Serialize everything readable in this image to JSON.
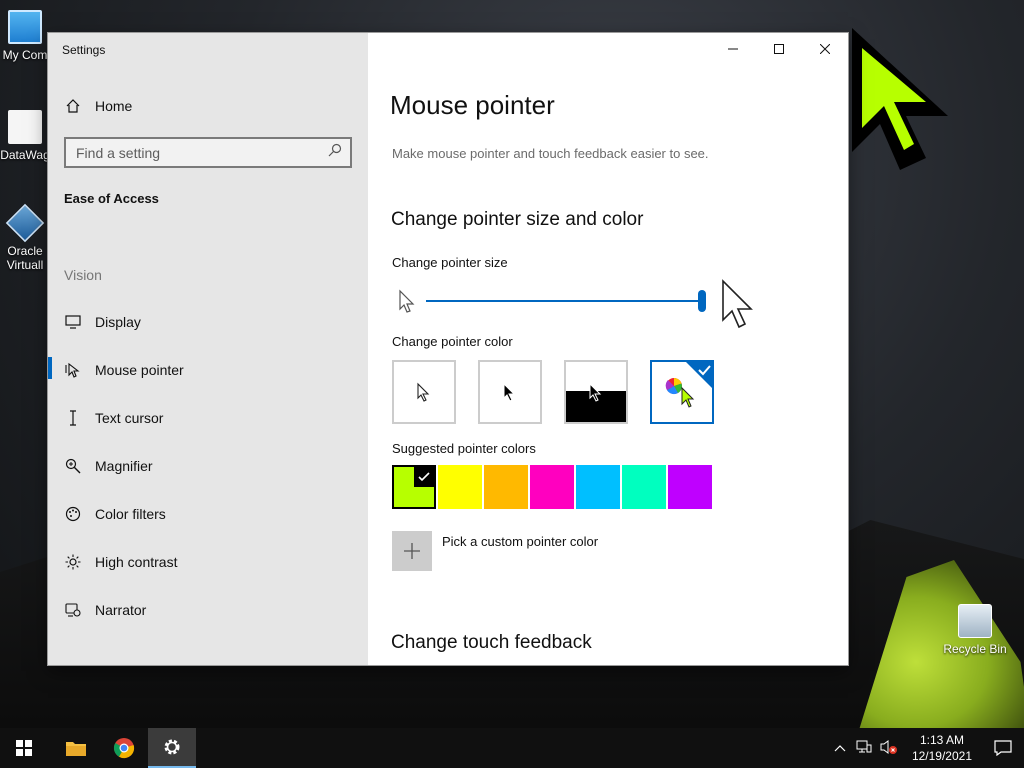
{
  "desktop": {
    "icons": [
      "My Com",
      "DataWag",
      "Oracle Virtuall",
      "Recycle Bin"
    ]
  },
  "window": {
    "title": "Settings",
    "controls": [
      "minimize-icon",
      "maximize-icon",
      "close-icon"
    ]
  },
  "sidebar": {
    "home": "Home",
    "search_placeholder": "Find a setting",
    "section": "Ease of Access",
    "group": "Vision",
    "items": [
      {
        "label": "Display",
        "icon": "display-icon"
      },
      {
        "label": "Mouse pointer",
        "icon": "mouse-pointer-icon",
        "active": true
      },
      {
        "label": "Text cursor",
        "icon": "text-cursor-icon"
      },
      {
        "label": "Magnifier",
        "icon": "magnifier-icon"
      },
      {
        "label": "Color filters",
        "icon": "color-filters-icon"
      },
      {
        "label": "High contrast",
        "icon": "high-contrast-icon"
      },
      {
        "label": "Narrator",
        "icon": "narrator-icon"
      }
    ]
  },
  "main": {
    "title": "Mouse pointer",
    "subtitle": "Make mouse pointer and touch feedback easier to see.",
    "section1": "Change pointer size and color",
    "size_label": "Change pointer size",
    "size_value_fraction": 1.0,
    "color_label": "Change pointer color",
    "color_options": [
      "white",
      "black",
      "inverted",
      "custom"
    ],
    "selected_color_option": "custom",
    "suggested_label": "Suggested pointer colors",
    "suggested_colors": [
      "#b7ff00",
      "#ffff00",
      "#ffb900",
      "#ff00bf",
      "#00bfff",
      "#00ffbf",
      "#bf00ff"
    ],
    "selected_suggested": "#b7ff00",
    "custom_label": "Pick a custom pointer color",
    "section2": "Change touch feedback"
  },
  "taskbar": {
    "time": "1:13 AM",
    "date": "12/19/2021"
  }
}
